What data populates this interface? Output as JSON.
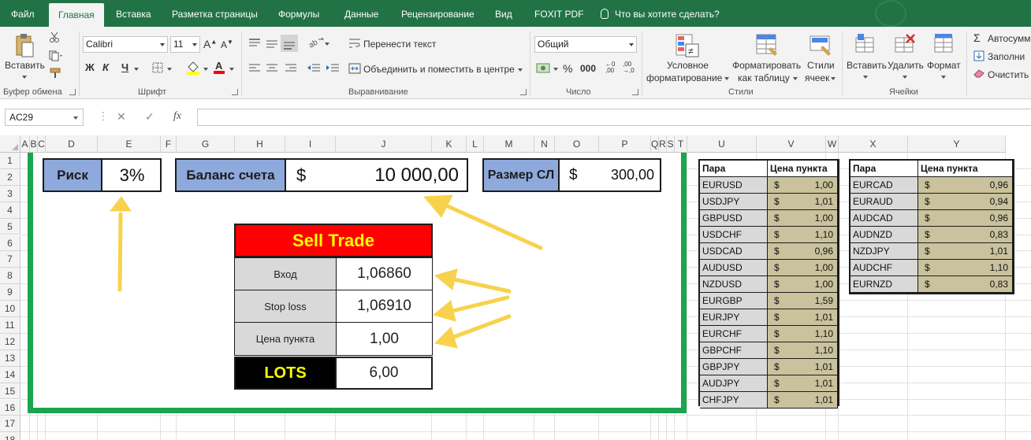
{
  "menu": {
    "tabs": [
      "Файл",
      "Главная",
      "Вставка",
      "Разметка страницы",
      "Формулы",
      "Данные",
      "Рецензирование",
      "Вид",
      "FOXIT PDF"
    ],
    "active": "Главная",
    "tellme": "Что вы хотите сделать?"
  },
  "ribbon": {
    "clipboard": {
      "paste": "Вставить",
      "label": "Буфер обмена"
    },
    "font": {
      "name": "Calibri",
      "size": "11",
      "bold": "Ж",
      "italic": "К",
      "underline": "Ч",
      "label": "Шрифт"
    },
    "alignment": {
      "wrap": "Перенести текст",
      "merge": "Объединить и поместить в центре",
      "label": "Выравнивание"
    },
    "number": {
      "format": "Общий",
      "label": "Число"
    },
    "styles": {
      "conditional_1": "Условное",
      "conditional_2": "форматирование",
      "table_1": "Форматировать",
      "table_2": "как таблицу",
      "cell_1": "Стили",
      "cell_2": "ячеек",
      "label": "Стили"
    },
    "cells": {
      "insert": "Вставить",
      "delete": "Удалить",
      "format": "Формат",
      "label": "Ячейки"
    },
    "editing": {
      "autosum": "Автосумм",
      "fill": "Заполни",
      "clear": "Очистить"
    }
  },
  "formula_bar": {
    "namebox": "AC29",
    "fx": "fx",
    "content": ""
  },
  "columns": [
    "A",
    "B",
    "C",
    "D",
    "E",
    "F",
    "G",
    "H",
    "I",
    "J",
    "K",
    "L",
    "M",
    "N",
    "O",
    "P",
    "Q",
    "R",
    "S",
    "T",
    "U",
    "V",
    "W",
    "X",
    "Y"
  ],
  "rows": [
    "1",
    "2",
    "3",
    "4",
    "5",
    "6",
    "7",
    "8",
    "9",
    "10",
    "11",
    "12",
    "13",
    "14",
    "15",
    "16",
    "17",
    "18"
  ],
  "inputs": {
    "risk_label": "Риск",
    "risk_value": "3%",
    "balance_label": "Баланс счета",
    "balance_currency": "$",
    "balance_value": "10 000,00",
    "sl_label": "Размер СЛ",
    "sl_currency": "$",
    "sl_value": "300,00"
  },
  "trade": {
    "title": "Sell Trade",
    "entry_label": "Вход",
    "entry_value": "1,06860",
    "stop_label": "Stop loss",
    "stop_value": "1,06910",
    "pip_label": "Цена пункта",
    "pip_value": "1,00",
    "lots_label": "LOTS",
    "lots_value": "6,00"
  },
  "pairs_table_1": {
    "header_pair": "Пара",
    "header_price": "Цена пункта",
    "rows": [
      {
        "pair": "EURUSD",
        "cur": "$",
        "value": "1,00"
      },
      {
        "pair": "USDJPY",
        "cur": "$",
        "value": "1,01"
      },
      {
        "pair": "GBPUSD",
        "cur": "$",
        "value": "1,00"
      },
      {
        "pair": "USDCHF",
        "cur": "$",
        "value": "1,10"
      },
      {
        "pair": "USDCAD",
        "cur": "$",
        "value": "0,96"
      },
      {
        "pair": "AUDUSD",
        "cur": "$",
        "value": "1,00"
      },
      {
        "pair": "NZDUSD",
        "cur": "$",
        "value": "1,00"
      },
      {
        "pair": "EURGBP",
        "cur": "$",
        "value": "1,59"
      },
      {
        "pair": "EURJPY",
        "cur": "$",
        "value": "1,01"
      },
      {
        "pair": "EURCHF",
        "cur": "$",
        "value": "1,10"
      },
      {
        "pair": "GBPCHF",
        "cur": "$",
        "value": "1,10"
      },
      {
        "pair": "GBPJPY",
        "cur": "$",
        "value": "1,01"
      },
      {
        "pair": "AUDJPY",
        "cur": "$",
        "value": "1,01"
      },
      {
        "pair": "CHFJPY",
        "cur": "$",
        "value": "1,01"
      }
    ]
  },
  "pairs_table_2": {
    "header_pair": "Пара",
    "header_price": "Цена пункта",
    "rows": [
      {
        "pair": "EURCAD",
        "cur": "$",
        "value": "0,96"
      },
      {
        "pair": "EURAUD",
        "cur": "$",
        "value": "0,94"
      },
      {
        "pair": "AUDCAD",
        "cur": "$",
        "value": "0,96"
      },
      {
        "pair": "AUDNZD",
        "cur": "$",
        "value": "0,83"
      },
      {
        "pair": "NZDJPY",
        "cur": "$",
        "value": "1,01"
      },
      {
        "pair": "AUDCHF",
        "cur": "$",
        "value": "1,10"
      },
      {
        "pair": "EURNZD",
        "cur": "$",
        "value": "0,83"
      }
    ]
  },
  "colors": {
    "excel_green": "#217346",
    "frame_green": "#1aa54e",
    "label_blue": "#8ea9db",
    "trade_red": "#ff0000",
    "lots_yellow": "#ffff00",
    "arrow_yellow": "#f8d24c",
    "price_fill": "#c9c29d",
    "pair_fill": "#d9d9d9"
  }
}
